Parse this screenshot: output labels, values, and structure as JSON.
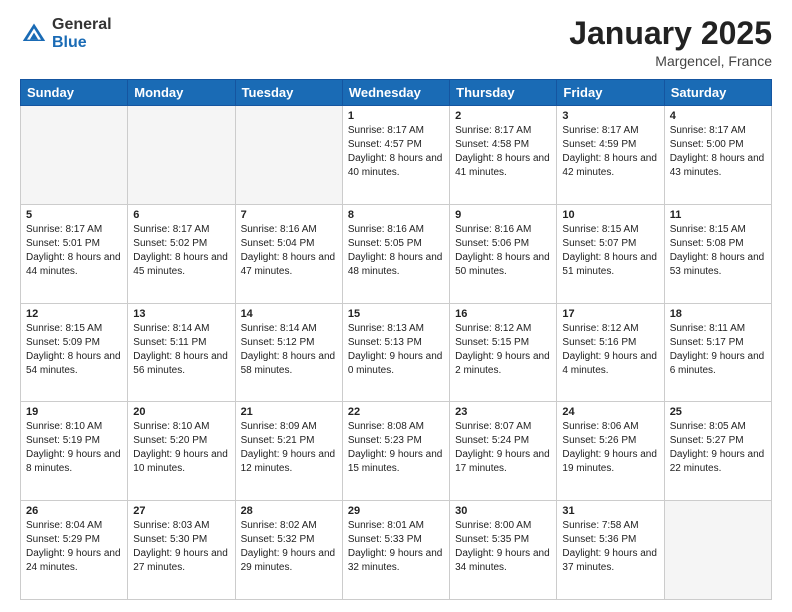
{
  "header": {
    "logo_general": "General",
    "logo_blue": "Blue",
    "title": "January 2025",
    "location": "Margencel, France"
  },
  "weekdays": [
    "Sunday",
    "Monday",
    "Tuesday",
    "Wednesday",
    "Thursday",
    "Friday",
    "Saturday"
  ],
  "weeks": [
    [
      {
        "day": "",
        "text": ""
      },
      {
        "day": "",
        "text": ""
      },
      {
        "day": "",
        "text": ""
      },
      {
        "day": "1",
        "text": "Sunrise: 8:17 AM\nSunset: 4:57 PM\nDaylight: 8 hours\nand 40 minutes."
      },
      {
        "day": "2",
        "text": "Sunrise: 8:17 AM\nSunset: 4:58 PM\nDaylight: 8 hours\nand 41 minutes."
      },
      {
        "day": "3",
        "text": "Sunrise: 8:17 AM\nSunset: 4:59 PM\nDaylight: 8 hours\nand 42 minutes."
      },
      {
        "day": "4",
        "text": "Sunrise: 8:17 AM\nSunset: 5:00 PM\nDaylight: 8 hours\nand 43 minutes."
      }
    ],
    [
      {
        "day": "5",
        "text": "Sunrise: 8:17 AM\nSunset: 5:01 PM\nDaylight: 8 hours\nand 44 minutes."
      },
      {
        "day": "6",
        "text": "Sunrise: 8:17 AM\nSunset: 5:02 PM\nDaylight: 8 hours\nand 45 minutes."
      },
      {
        "day": "7",
        "text": "Sunrise: 8:16 AM\nSunset: 5:04 PM\nDaylight: 8 hours\nand 47 minutes."
      },
      {
        "day": "8",
        "text": "Sunrise: 8:16 AM\nSunset: 5:05 PM\nDaylight: 8 hours\nand 48 minutes."
      },
      {
        "day": "9",
        "text": "Sunrise: 8:16 AM\nSunset: 5:06 PM\nDaylight: 8 hours\nand 50 minutes."
      },
      {
        "day": "10",
        "text": "Sunrise: 8:15 AM\nSunset: 5:07 PM\nDaylight: 8 hours\nand 51 minutes."
      },
      {
        "day": "11",
        "text": "Sunrise: 8:15 AM\nSunset: 5:08 PM\nDaylight: 8 hours\nand 53 minutes."
      }
    ],
    [
      {
        "day": "12",
        "text": "Sunrise: 8:15 AM\nSunset: 5:09 PM\nDaylight: 8 hours\nand 54 minutes."
      },
      {
        "day": "13",
        "text": "Sunrise: 8:14 AM\nSunset: 5:11 PM\nDaylight: 8 hours\nand 56 minutes."
      },
      {
        "day": "14",
        "text": "Sunrise: 8:14 AM\nSunset: 5:12 PM\nDaylight: 8 hours\nand 58 minutes."
      },
      {
        "day": "15",
        "text": "Sunrise: 8:13 AM\nSunset: 5:13 PM\nDaylight: 9 hours\nand 0 minutes."
      },
      {
        "day": "16",
        "text": "Sunrise: 8:12 AM\nSunset: 5:15 PM\nDaylight: 9 hours\nand 2 minutes."
      },
      {
        "day": "17",
        "text": "Sunrise: 8:12 AM\nSunset: 5:16 PM\nDaylight: 9 hours\nand 4 minutes."
      },
      {
        "day": "18",
        "text": "Sunrise: 8:11 AM\nSunset: 5:17 PM\nDaylight: 9 hours\nand 6 minutes."
      }
    ],
    [
      {
        "day": "19",
        "text": "Sunrise: 8:10 AM\nSunset: 5:19 PM\nDaylight: 9 hours\nand 8 minutes."
      },
      {
        "day": "20",
        "text": "Sunrise: 8:10 AM\nSunset: 5:20 PM\nDaylight: 9 hours\nand 10 minutes."
      },
      {
        "day": "21",
        "text": "Sunrise: 8:09 AM\nSunset: 5:21 PM\nDaylight: 9 hours\nand 12 minutes."
      },
      {
        "day": "22",
        "text": "Sunrise: 8:08 AM\nSunset: 5:23 PM\nDaylight: 9 hours\nand 15 minutes."
      },
      {
        "day": "23",
        "text": "Sunrise: 8:07 AM\nSunset: 5:24 PM\nDaylight: 9 hours\nand 17 minutes."
      },
      {
        "day": "24",
        "text": "Sunrise: 8:06 AM\nSunset: 5:26 PM\nDaylight: 9 hours\nand 19 minutes."
      },
      {
        "day": "25",
        "text": "Sunrise: 8:05 AM\nSunset: 5:27 PM\nDaylight: 9 hours\nand 22 minutes."
      }
    ],
    [
      {
        "day": "26",
        "text": "Sunrise: 8:04 AM\nSunset: 5:29 PM\nDaylight: 9 hours\nand 24 minutes."
      },
      {
        "day": "27",
        "text": "Sunrise: 8:03 AM\nSunset: 5:30 PM\nDaylight: 9 hours\nand 27 minutes."
      },
      {
        "day": "28",
        "text": "Sunrise: 8:02 AM\nSunset: 5:32 PM\nDaylight: 9 hours\nand 29 minutes."
      },
      {
        "day": "29",
        "text": "Sunrise: 8:01 AM\nSunset: 5:33 PM\nDaylight: 9 hours\nand 32 minutes."
      },
      {
        "day": "30",
        "text": "Sunrise: 8:00 AM\nSunset: 5:35 PM\nDaylight: 9 hours\nand 34 minutes."
      },
      {
        "day": "31",
        "text": "Sunrise: 7:58 AM\nSunset: 5:36 PM\nDaylight: 9 hours\nand 37 minutes."
      },
      {
        "day": "",
        "text": ""
      }
    ]
  ]
}
